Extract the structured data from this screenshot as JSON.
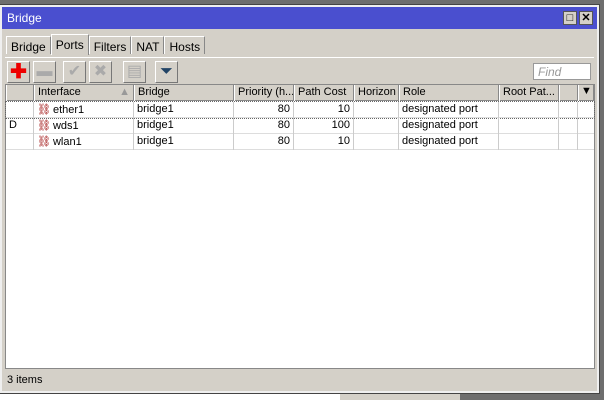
{
  "window": {
    "title": "Bridge",
    "maximize": "□",
    "close": "✕"
  },
  "tabs": [
    "Bridge",
    "Ports",
    "Filters",
    "NAT",
    "Hosts"
  ],
  "toolbar": {
    "find_placeholder": "Find"
  },
  "table": {
    "columns": [
      "",
      "Interface",
      "Bridge",
      "Priority (h...",
      "Path Cost",
      "Horizon",
      "Role",
      "Root Pat...",
      ""
    ],
    "rows": [
      {
        "flag": "",
        "interface": "ether1",
        "bridge": "bridge1",
        "priority": "80",
        "path_cost": "10",
        "horizon": "",
        "role": "designated port",
        "root_path": ""
      },
      {
        "flag": "D",
        "interface": "wds1",
        "bridge": "bridge1",
        "priority": "80",
        "path_cost": "100",
        "horizon": "",
        "role": "designated port",
        "root_path": ""
      },
      {
        "flag": "",
        "interface": "wlan1",
        "bridge": "bridge1",
        "priority": "80",
        "path_cost": "10",
        "horizon": "",
        "role": "designated port",
        "root_path": ""
      }
    ]
  },
  "status": "3 items"
}
